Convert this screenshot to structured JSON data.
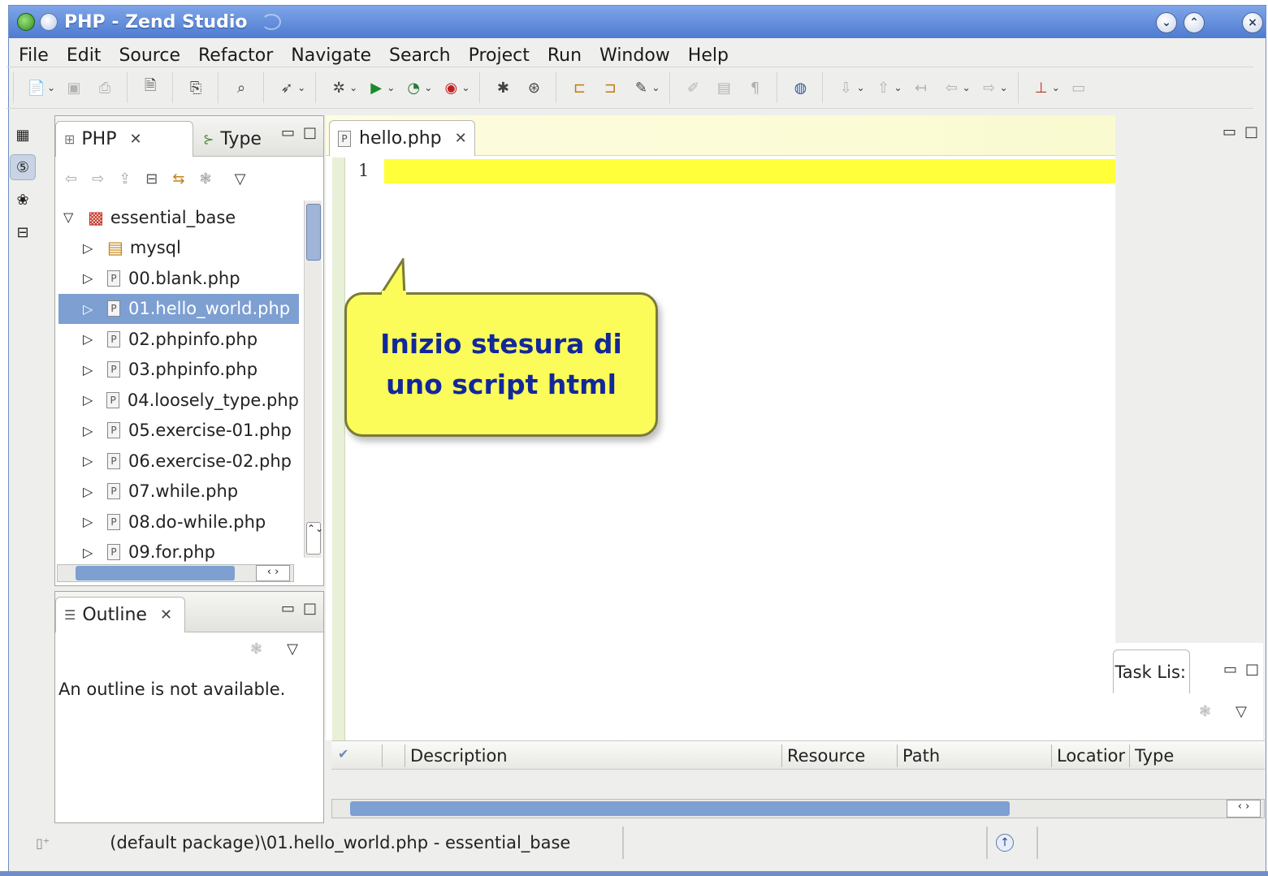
{
  "window": {
    "title": "PHP - Zend Studio"
  },
  "menu": [
    "File",
    "Edit",
    "Source",
    "Refactor",
    "Navigate",
    "Search",
    "Project",
    "Run",
    "Window",
    "Help"
  ],
  "left_panel": {
    "tabs": [
      "PHP",
      "Type"
    ],
    "tree": {
      "root": "essential_base",
      "items": [
        "mysql",
        "00.blank.php",
        "01.hello_world.php",
        "02.phpinfo.php",
        "03.phpinfo.php",
        "04.loosely_type.php",
        "05.exercise-01.php",
        "06.exercise-02.php",
        "07.while.php",
        "08.do-while.php",
        "09.for.php"
      ],
      "selected_index": 2
    }
  },
  "outline": {
    "tab": "Outline",
    "message": "An outline is not available."
  },
  "editor": {
    "tab": "hello.php",
    "line_number": "1"
  },
  "callout": {
    "line1": "Inizio stesura di",
    "line2": "uno script html"
  },
  "task_panel": {
    "tab": "Task Lis:",
    "columns": [
      "Description",
      "Resource",
      "Path",
      "Locatior",
      "Type"
    ]
  },
  "status": {
    "text": "(default package)\\01.hello_world.php - essential_base"
  }
}
